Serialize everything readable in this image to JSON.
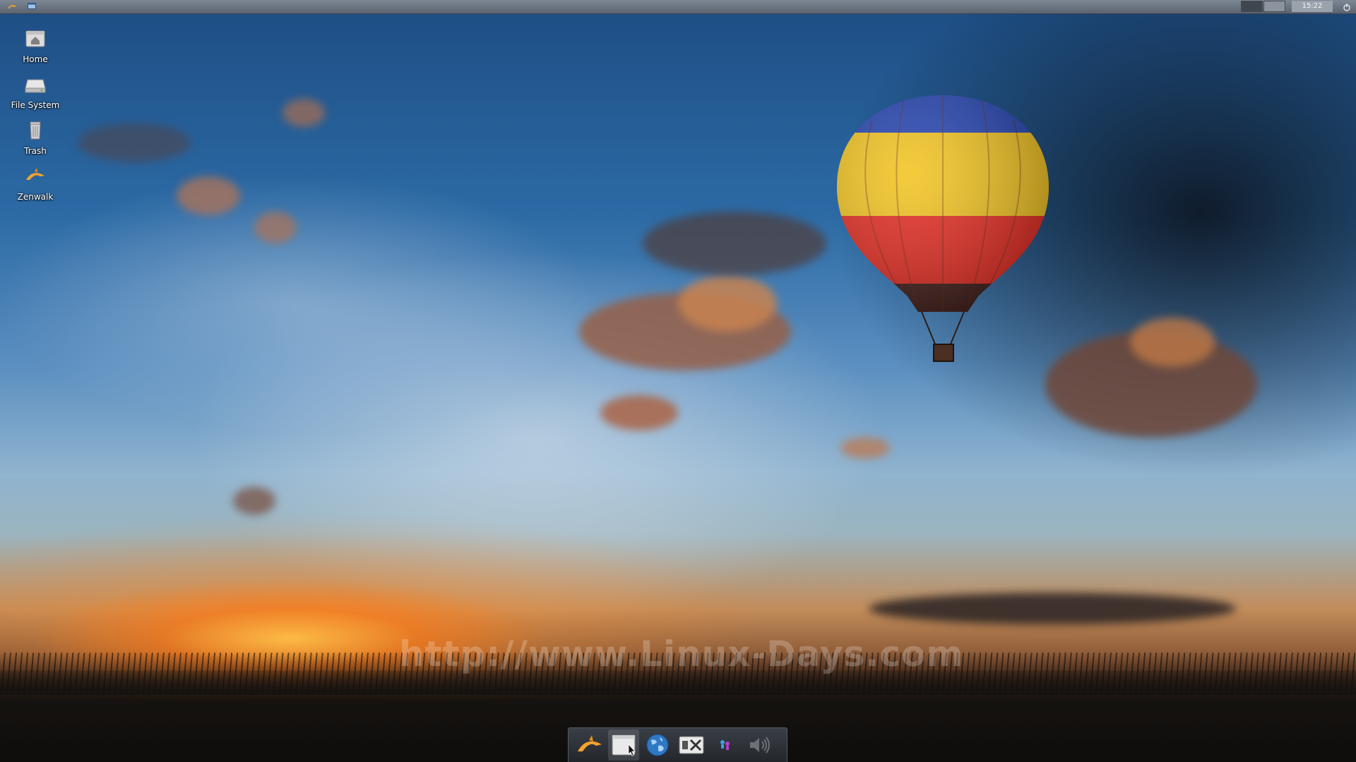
{
  "desktop": {
    "icons": [
      {
        "label": "Home",
        "icon": "home-folder-icon"
      },
      {
        "label": "File System",
        "icon": "drive-icon"
      },
      {
        "label": "Trash",
        "icon": "trash-icon"
      },
      {
        "label": "Zenwalk",
        "icon": "zenwalk-dolphin-icon"
      }
    ],
    "watermark": "http://www.Linux-Days.com"
  },
  "top_panel": {
    "left_buttons": [
      {
        "icon": "zenwalk-menu-icon"
      },
      {
        "icon": "show-desktop-icon"
      }
    ],
    "workspaces": [
      {
        "name": "workspace-1",
        "active": true
      },
      {
        "name": "workspace-2",
        "active": false
      }
    ],
    "clock": "15:22",
    "right_button_icon": "logout-icon"
  },
  "dock": {
    "items": [
      {
        "icon": "zenwalk-dolphin-icon",
        "active": false
      },
      {
        "icon": "file-manager-icon",
        "active": true
      },
      {
        "icon": "web-browser-globe-icon",
        "active": false
      },
      {
        "icon": "settings-tools-icon",
        "active": false
      },
      {
        "icon": "messenger-icon",
        "active": false
      },
      {
        "icon": "volume-icon",
        "active": false
      }
    ]
  },
  "colors": {
    "panel": "#6b7480",
    "clock_bg": "#9aa2ac",
    "dock_bg": "#2d3238",
    "sun": "#ffb84a",
    "balloon_blue": "#1f3fb0",
    "balloon_yellow": "#f2c21a",
    "balloon_red": "#e3261b"
  }
}
